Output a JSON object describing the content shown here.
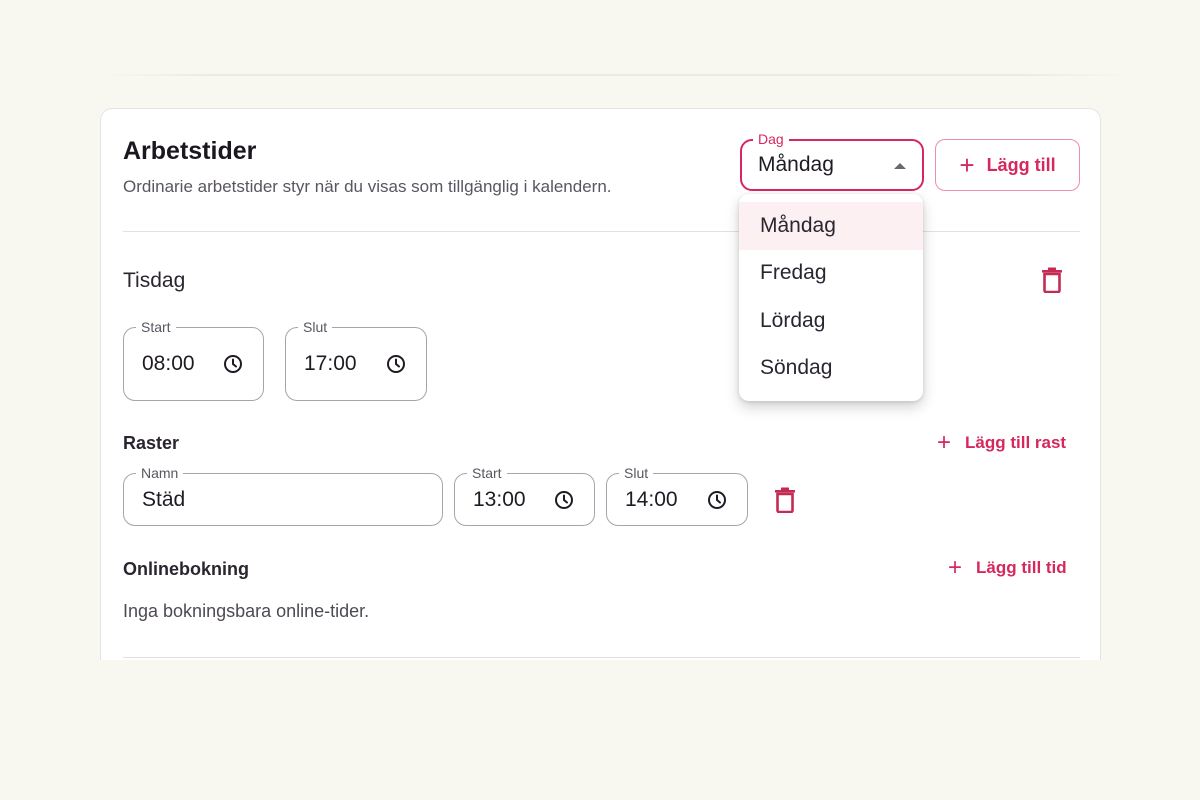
{
  "card": {
    "title": "Arbetstider",
    "subtitle": "Ordinarie arbetstider styr när du visas som tillgänglig i kalendern."
  },
  "day_select": {
    "label": "Dag",
    "value": "Måndag",
    "options": [
      "Måndag",
      "Fredag",
      "Lördag",
      "Söndag"
    ]
  },
  "add_button": {
    "label": "Lägg till"
  },
  "day": {
    "name": "Tisdag",
    "start": {
      "label": "Start",
      "value": "08:00"
    },
    "end": {
      "label": "Slut",
      "value": "17:00"
    }
  },
  "breaks": {
    "label": "Raster",
    "add_label": "Lägg till rast",
    "items": [
      {
        "name_label": "Namn",
        "name": "Städ",
        "start_label": "Start",
        "start": "13:00",
        "end_label": "Slut",
        "end": "14:00"
      }
    ]
  },
  "online": {
    "label": "Onlinebokning",
    "add_label": "Lägg till tid",
    "empty_text": "Inga bokningsbara online-tider."
  },
  "colors": {
    "accent": "#d6285e",
    "background": "#f8f8f1",
    "card": "#ffffff"
  }
}
